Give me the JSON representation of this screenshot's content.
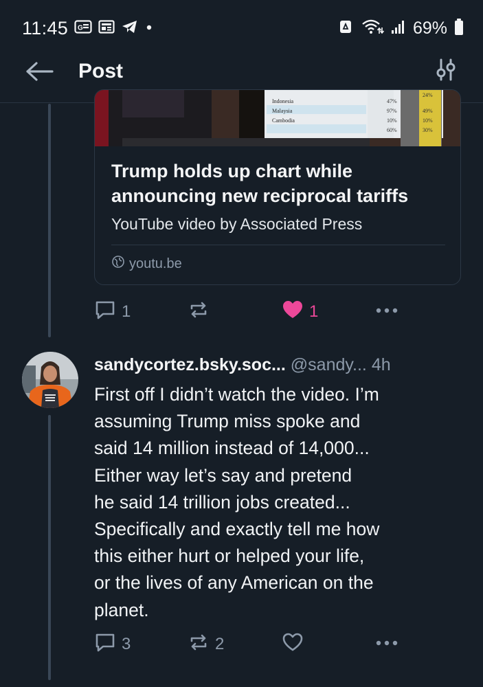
{
  "status_bar": {
    "time": "11:45",
    "battery": "69%",
    "icons_left": [
      "sim-card-icon",
      "news-icon",
      "telegram-icon",
      "dot-icon"
    ],
    "icons_right": [
      "nfc-icon",
      "wifi-icon",
      "signal-icon",
      "battery-icon"
    ]
  },
  "header": {
    "title": "Post",
    "back_icon": "arrow-left-icon",
    "filter_icon": "sliders-icon"
  },
  "embed": {
    "title": "Trump holds up chart while announcing new reciprocal tariffs",
    "description": "YouTube video by Associated Press",
    "link": "youtu.be",
    "thumbnail_rows": [
      {
        "country": "Indonesia",
        "v1": "47%",
        "v2": "24%"
      },
      {
        "country": "Malaysia",
        "v1": "97%",
        "v2": "49%"
      },
      {
        "country": "Cambodia",
        "v1": "10%",
        "v2": "10%"
      },
      {
        "country": "",
        "v1": "60%",
        "v2": "30%"
      }
    ]
  },
  "post_actions": {
    "replies": "1",
    "reposts": "",
    "likes": "1"
  },
  "reply": {
    "display_name": "sandycortez.bsky.soc...",
    "handle": "@sandy...",
    "time": "4h",
    "lines": [
      "First off I didn’t watch the video. I’m",
      "assuming Trump miss spoke and",
      "said 14 million instead of 14,000...",
      "Either way let’s say and pretend",
      "he said 14 trillion jobs created...",
      "Specifically and exactly tell me how",
      "this either hurt or helped your life,",
      "or the lives of any American on the",
      "planet."
    ],
    "actions": {
      "replies": "3",
      "reposts": "2",
      "likes": ""
    }
  },
  "colors": {
    "background": "#161e27",
    "text": "#f1f3f5",
    "muted": "#8d9aaa",
    "like": "#ec4899",
    "border": "#2c3846"
  }
}
